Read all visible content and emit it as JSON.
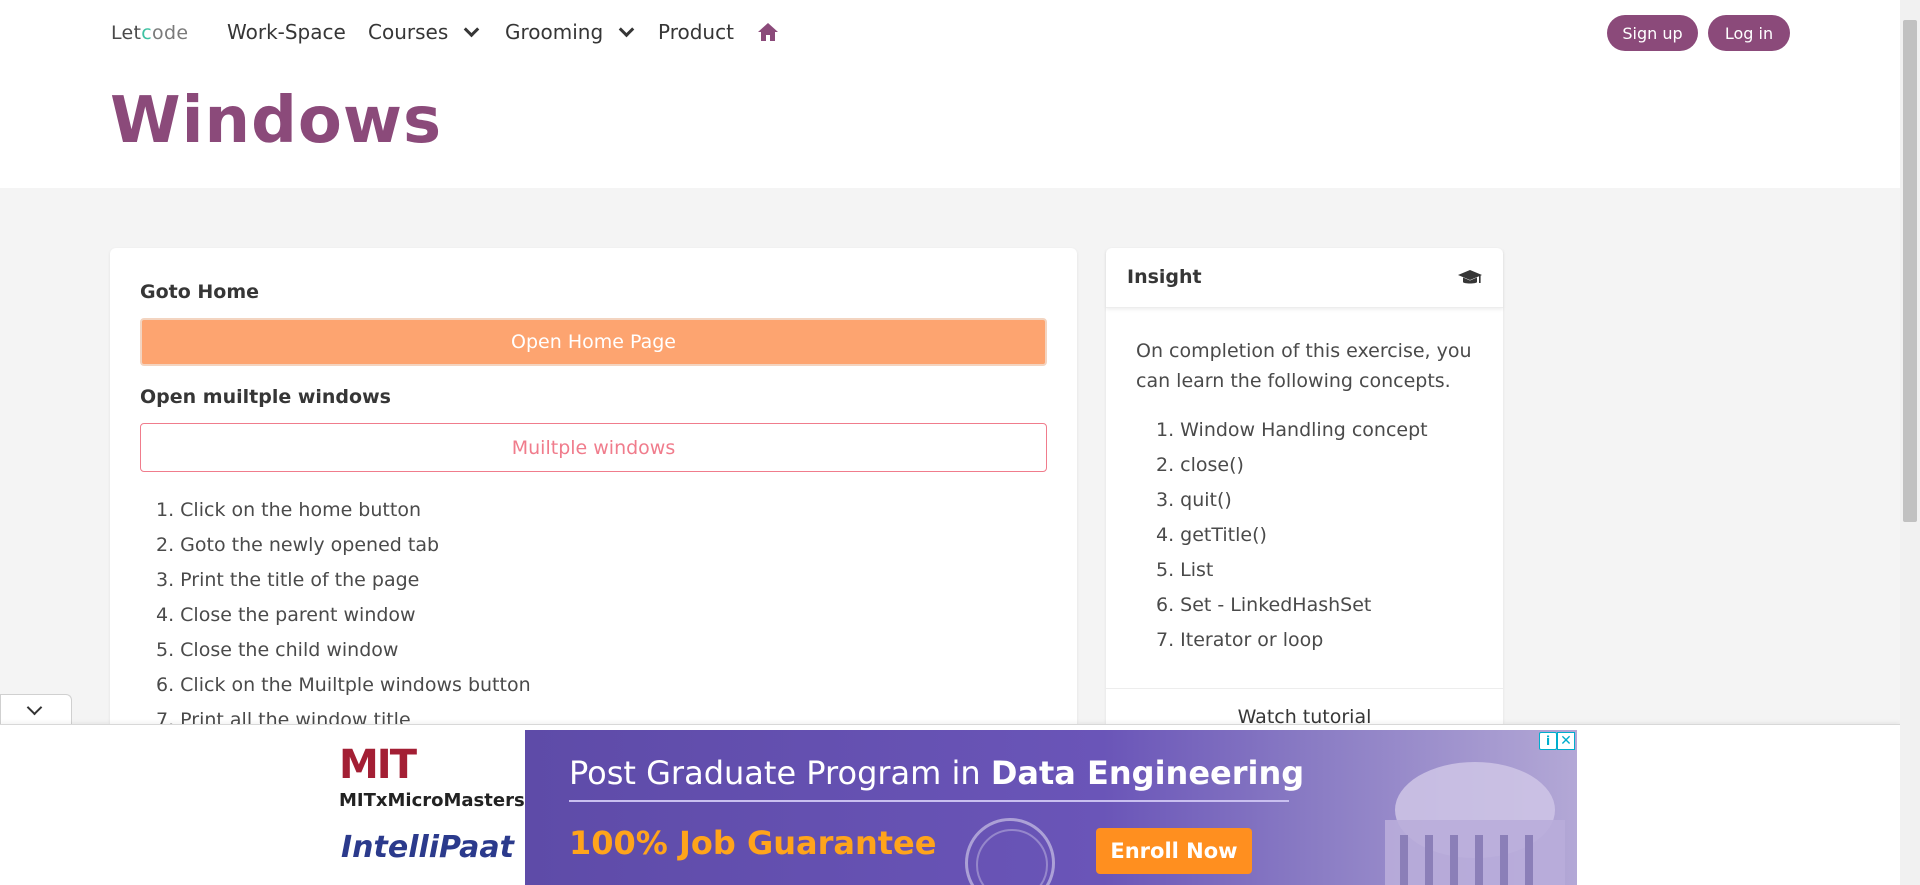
{
  "nav": {
    "brand_let": "Let",
    "brand_co": "c",
    "brand_de": "ode",
    "items": [
      {
        "label": "Work-Space"
      },
      {
        "label": "Courses"
      },
      {
        "label": "Grooming"
      },
      {
        "label": "Product"
      }
    ],
    "signup": "Sign up",
    "login": "Log in"
  },
  "page_title": "Windows",
  "main": {
    "goto_label": "Goto Home",
    "open_home_button": "Open Home Page",
    "multi_label": "Open muiltple windows",
    "multi_button": "Muiltple windows",
    "steps": [
      "1. Click on the home button",
      "2. Goto the newly opened tab",
      "3. Print the title of the page",
      "4. Close the parent window",
      "5. Close the child window",
      "6. Click on the Muiltple windows button",
      "7. Print all the window title"
    ]
  },
  "insight": {
    "title": "Insight",
    "intro": "On completion of this exercise, you can learn the following concepts.",
    "concepts": [
      "1. Window Handling concept",
      "2. close()",
      "3. quit()",
      "4. getTitle()",
      "5. List",
      "6. Set - LinkedHashSet",
      "7. Iterator or loop"
    ],
    "watch": "Watch tutorial"
  },
  "ad": {
    "mit": "MIT",
    "mitx": "MITxMicroMasters",
    "intellipaat": "IntelliPaat",
    "headline_plain": "Post Graduate Program in ",
    "headline_bold": "Data Engineering",
    "guarantee": "100% Job Guarantee",
    "enroll": "Enroll Now",
    "info": "i",
    "close": "✕"
  },
  "colors": {
    "brand": "#8b4a7a",
    "primary_button": "#fda470",
    "outline_button": "#f07c8c"
  },
  "icons": [
    "home-icon",
    "chevron-down-icon",
    "graduation-cap-icon",
    "info-icon",
    "close-icon"
  ]
}
